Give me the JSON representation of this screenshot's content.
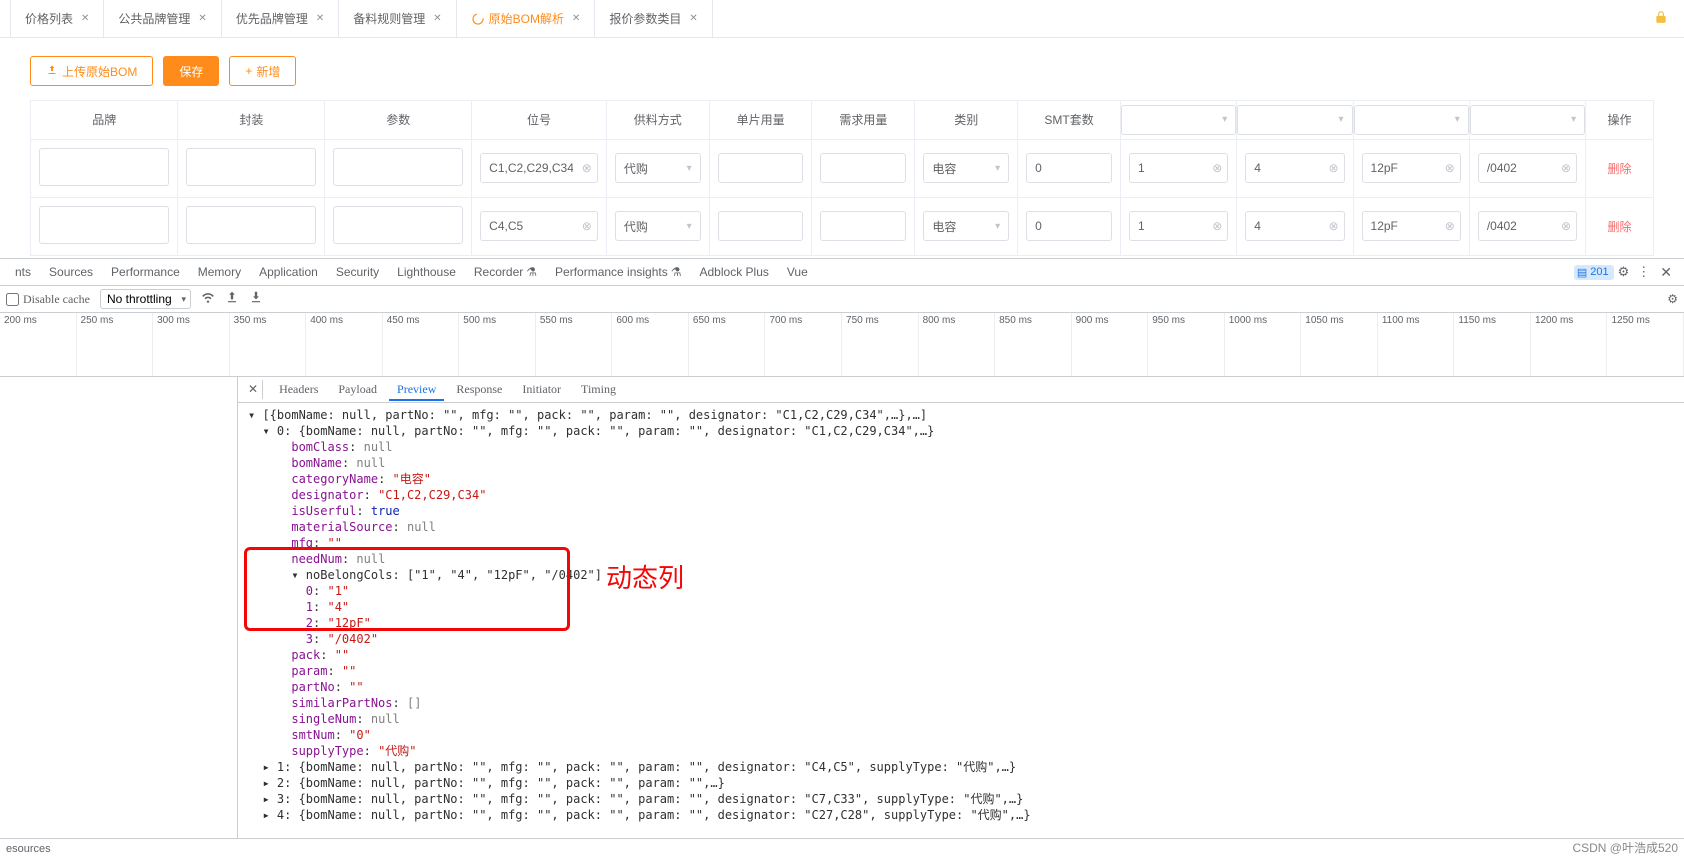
{
  "tabs": [
    {
      "label": "价格列表",
      "active": false
    },
    {
      "label": "公共品牌管理",
      "active": false
    },
    {
      "label": "优先品牌管理",
      "active": false
    },
    {
      "label": "备料规则管理",
      "active": false
    },
    {
      "label": "原始BOM解析",
      "active": true
    },
    {
      "label": "报价参数类目",
      "active": false
    }
  ],
  "toolbar": {
    "upload": "上传原始BOM",
    "save": "保存",
    "add": "新增"
  },
  "table": {
    "headers": [
      "品牌",
      "封装",
      "参数",
      "位号",
      "供料方式",
      "单片用量",
      "需求用量",
      "类别",
      "SMT套数",
      "",
      "",
      "",
      "",
      "操作"
    ],
    "deleteLabel": "删除",
    "rows": [
      {
        "brand": "",
        "pack": "",
        "param": "",
        "designator": "C1,C2,C29,C34",
        "supply": "代购",
        "single": "",
        "need": "",
        "category": "电容",
        "smt": "0",
        "dyn": [
          "1",
          "4",
          "12pF",
          "/0402"
        ]
      },
      {
        "brand": "",
        "pack": "",
        "param": "",
        "designator": "C4,C5",
        "supply": "代购",
        "single": "",
        "need": "",
        "category": "电容",
        "smt": "0",
        "dyn": [
          "1",
          "4",
          "12pF",
          "/0402"
        ]
      }
    ]
  },
  "devtools": {
    "panels": [
      "nts",
      "Sources",
      "Performance",
      "Memory",
      "Application",
      "Security",
      "Lighthouse",
      "Recorder",
      "Performance insights",
      "Adblock Plus",
      "Vue"
    ],
    "flask1": "⚗",
    "flask2": "⚗",
    "issueCount": "201",
    "disableCache": "Disable cache",
    "throttling": "No throttling",
    "timeline": [
      "200 ms",
      "250 ms",
      "300 ms",
      "350 ms",
      "400 ms",
      "450 ms",
      "500 ms",
      "550 ms",
      "600 ms",
      "650 ms",
      "700 ms",
      "750 ms",
      "800 ms",
      "850 ms",
      "900 ms",
      "950 ms",
      "1000 ms",
      "1050 ms",
      "1100 ms",
      "1150 ms",
      "1200 ms",
      "1250 ms"
    ],
    "detailTabs": [
      "Headers",
      "Payload",
      "Preview",
      "Response",
      "Initiator",
      "Timing"
    ],
    "activeDetailTab": "Preview",
    "footer": "esources",
    "annotation": "动态列",
    "json": {
      "line0": "▾ [{bomName: null, partNo: \"\", mfg: \"\", pack: \"\", param: \"\", designator: \"C1,C2,C29,C34\",…},…]",
      "line1": "  ▾ 0: {bomName: null, partNo: \"\", mfg: \"\", pack: \"\", param: \"\", designator: \"C1,C2,C29,C34\",…}",
      "kv": [
        {
          "k": "bomClass",
          "v": "null",
          "t": "null"
        },
        {
          "k": "bomName",
          "v": "null",
          "t": "null"
        },
        {
          "k": "categoryName",
          "v": "\"电容\"",
          "t": "str"
        },
        {
          "k": "designator",
          "v": "\"C1,C2,C29,C34\"",
          "t": "str"
        },
        {
          "k": "isUserful",
          "v": "true",
          "t": "bool"
        },
        {
          "k": "materialSource",
          "v": "null",
          "t": "null"
        },
        {
          "k": "mfg",
          "v": "\"\"",
          "t": "str"
        },
        {
          "k": "needNum",
          "v": "null",
          "t": "null"
        }
      ],
      "noBelongHeader": "      ▾ noBelongCols: [\"1\", \"4\", \"12pF\", \"/0402\"]",
      "noBelong": [
        {
          "k": "0",
          "v": "\"1\""
        },
        {
          "k": "1",
          "v": "\"4\""
        },
        {
          "k": "2",
          "v": "\"12pF\""
        },
        {
          "k": "3",
          "v": "\"/0402\""
        }
      ],
      "kv2": [
        {
          "k": "pack",
          "v": "\"\"",
          "t": "str"
        },
        {
          "k": "param",
          "v": "\"\"",
          "t": "str"
        },
        {
          "k": "partNo",
          "v": "\"\"",
          "t": "str"
        },
        {
          "k": "similarPartNos",
          "v": "[]",
          "t": "null"
        },
        {
          "k": "singleNum",
          "v": "null",
          "t": "null"
        },
        {
          "k": "smtNum",
          "v": "\"0\"",
          "t": "str"
        },
        {
          "k": "supplyType",
          "v": "\"代购\"",
          "t": "str"
        }
      ],
      "tail": [
        "  ▸ 1: {bomName: null, partNo: \"\", mfg: \"\", pack: \"\", param: \"\", designator: \"C4,C5\", supplyType: \"代购\",…}",
        "  ▸ 2: {bomName: null, partNo: \"\", mfg: \"\", pack: \"\", param: \"\",…}",
        "  ▸ 3: {bomName: null, partNo: \"\", mfg: \"\", pack: \"\", param: \"\", designator: \"C7,C33\", supplyType: \"代购\",…}",
        "  ▸ 4: {bomName: null, partNo: \"\", mfg: \"\", pack: \"\", param: \"\", designator: \"C27,C28\", supplyType: \"代购\",…}"
      ]
    }
  },
  "watermark": "CSDN @叶浩成520"
}
